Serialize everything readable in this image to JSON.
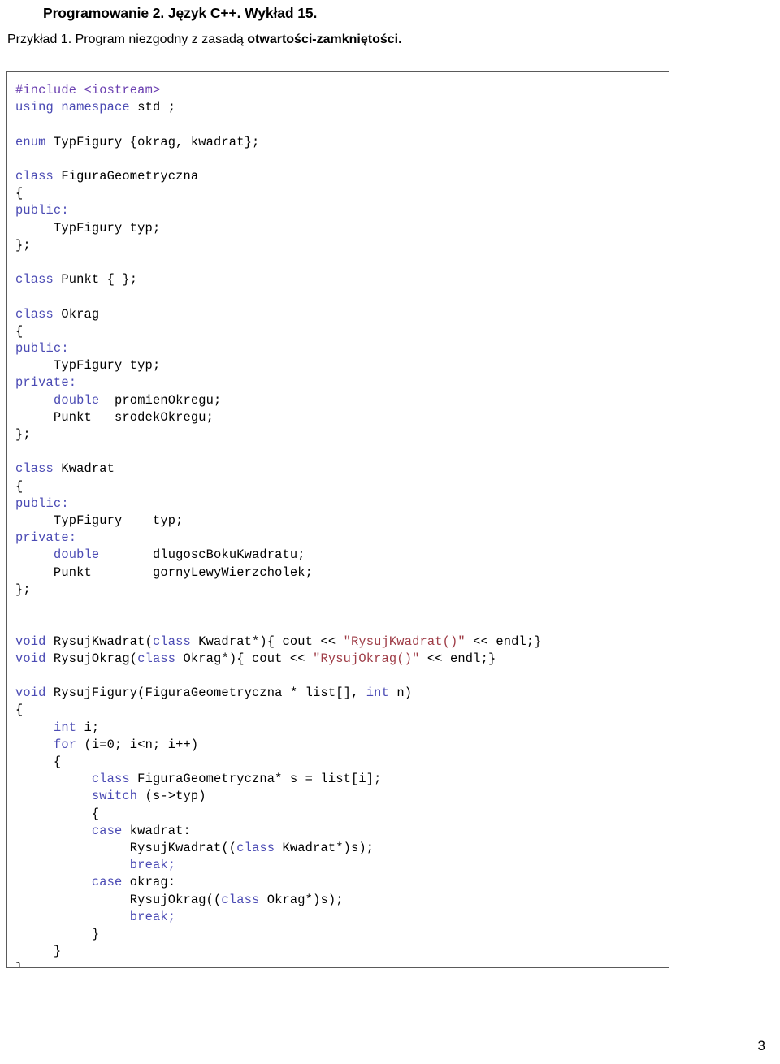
{
  "document": {
    "title": "Programowanie 2. Język C++. Wykład 15.",
    "example_prefix": "Przykład 1. Program niezgodny z zasadą ",
    "example_bold": "otwartości-zamkniętości.",
    "page_number": "3"
  },
  "colors": {
    "keyword": "#4b4bb4",
    "preprocessor": "#6a3fb0",
    "string": "#9e3b45",
    "plain": "#000000",
    "box_border": "#5a5a5a",
    "background": "#ffffff"
  },
  "code": {
    "language": "C++",
    "plain_text": "#include <iostream>\nusing namespace std ;\n\nenum TypFigury {okrag, kwadrat};\n\nclass FiguraGeometryczna\n{\npublic:\n     TypFigury typ;\n};\n\nclass Punkt { };\n\nclass Okrag\n{\npublic:\n     TypFigury typ;\nprivate:\n     double  promienOkregu;\n     Punkt   srodekOkregu;\n};\n\nclass Kwadrat\n{\npublic:\n     TypFigury    typ;\nprivate:\n     double       dlugoscBokuKwadratu;\n     Punkt        gornyLewyWierzcholek;\n};\n\n\nvoid RysujKwadrat(class Kwadrat*){ cout << \"RysujKwadrat()\" << endl;}\nvoid RysujOkrag(class Okrag*){ cout << \"RysujOkrag()\" << endl;}\n\nvoid RysujFigury(FiguraGeometryczna * list[], int n)\n{\n     int i;\n     for (i=0; i<n; i++)\n     {\n          class FiguraGeometryczna* s = list[i];\n          switch (s->typ)\n          {\n          case kwadrat:\n               RysujKwadrat((class Kwadrat*)s);\n               break;\n          case okrag:\n               RysujOkrag((class Okrag*)s);\n               break;\n          }\n     }\n}",
    "lines": [
      [
        {
          "t": "#include",
          "c": "pp"
        },
        {
          "t": " <iostream>",
          "c": "pp"
        }
      ],
      [
        {
          "t": "using",
          "c": "kw"
        },
        {
          "t": " ",
          "c": "pl"
        },
        {
          "t": "namespace",
          "c": "kw"
        },
        {
          "t": " std ;",
          "c": "pl"
        }
      ],
      [],
      [
        {
          "t": "enum",
          "c": "kw"
        },
        {
          "t": " TypFigury {okrag, kwadrat};",
          "c": "pl"
        }
      ],
      [],
      [
        {
          "t": "class",
          "c": "kw"
        },
        {
          "t": " FiguraGeometryczna",
          "c": "pl"
        }
      ],
      [
        {
          "t": "{",
          "c": "pl"
        }
      ],
      [
        {
          "t": "public:",
          "c": "kw"
        }
      ],
      [
        {
          "t": "     TypFigury typ;",
          "c": "pl"
        }
      ],
      [
        {
          "t": "};",
          "c": "pl"
        }
      ],
      [],
      [
        {
          "t": "class",
          "c": "kw"
        },
        {
          "t": " Punkt { };",
          "c": "pl"
        }
      ],
      [],
      [
        {
          "t": "class",
          "c": "kw"
        },
        {
          "t": " Okrag",
          "c": "pl"
        }
      ],
      [
        {
          "t": "{",
          "c": "pl"
        }
      ],
      [
        {
          "t": "public:",
          "c": "kw"
        }
      ],
      [
        {
          "t": "     TypFigury typ;",
          "c": "pl"
        }
      ],
      [
        {
          "t": "private:",
          "c": "kw"
        }
      ],
      [
        {
          "t": "     ",
          "c": "pl"
        },
        {
          "t": "double",
          "c": "kw"
        },
        {
          "t": "  promienOkregu;",
          "c": "pl"
        }
      ],
      [
        {
          "t": "     Punkt   srodekOkregu;",
          "c": "pl"
        }
      ],
      [
        {
          "t": "};",
          "c": "pl"
        }
      ],
      [],
      [
        {
          "t": "class",
          "c": "kw"
        },
        {
          "t": " Kwadrat",
          "c": "pl"
        }
      ],
      [
        {
          "t": "{",
          "c": "pl"
        }
      ],
      [
        {
          "t": "public:",
          "c": "kw"
        }
      ],
      [
        {
          "t": "     TypFigury    typ;",
          "c": "pl"
        }
      ],
      [
        {
          "t": "private:",
          "c": "kw"
        }
      ],
      [
        {
          "t": "     ",
          "c": "pl"
        },
        {
          "t": "double",
          "c": "kw"
        },
        {
          "t": "       dlugoscBokuKwadratu;",
          "c": "pl"
        }
      ],
      [
        {
          "t": "     Punkt        gornyLewyWierzcholek;",
          "c": "pl"
        }
      ],
      [
        {
          "t": "};",
          "c": "pl"
        }
      ],
      [],
      [],
      [
        {
          "t": "void",
          "c": "kw"
        },
        {
          "t": " RysujKwadrat(",
          "c": "pl"
        },
        {
          "t": "class",
          "c": "kw"
        },
        {
          "t": " Kwadrat*){ cout << ",
          "c": "pl"
        },
        {
          "t": "\"RysujKwadrat()\"",
          "c": "str"
        },
        {
          "t": " << endl;}",
          "c": "pl"
        }
      ],
      [
        {
          "t": "void",
          "c": "kw"
        },
        {
          "t": " RysujOkrag(",
          "c": "pl"
        },
        {
          "t": "class",
          "c": "kw"
        },
        {
          "t": " Okrag*){ cout << ",
          "c": "pl"
        },
        {
          "t": "\"RysujOkrag()\"",
          "c": "str"
        },
        {
          "t": " << endl;}",
          "c": "pl"
        }
      ],
      [],
      [
        {
          "t": "void",
          "c": "kw"
        },
        {
          "t": " RysujFigury(FiguraGeometryczna * list[], ",
          "c": "pl"
        },
        {
          "t": "int",
          "c": "kw"
        },
        {
          "t": " n)",
          "c": "pl"
        }
      ],
      [
        {
          "t": "{",
          "c": "pl"
        }
      ],
      [
        {
          "t": "     ",
          "c": "pl"
        },
        {
          "t": "int",
          "c": "kw"
        },
        {
          "t": " i;",
          "c": "pl"
        }
      ],
      [
        {
          "t": "     ",
          "c": "pl"
        },
        {
          "t": "for",
          "c": "kw"
        },
        {
          "t": " (i=0; i<n; i++)",
          "c": "pl"
        }
      ],
      [
        {
          "t": "     {",
          "c": "pl"
        }
      ],
      [
        {
          "t": "          ",
          "c": "pl"
        },
        {
          "t": "class",
          "c": "kw"
        },
        {
          "t": " FiguraGeometryczna* s = list[i];",
          "c": "pl"
        }
      ],
      [
        {
          "t": "          ",
          "c": "pl"
        },
        {
          "t": "switch",
          "c": "kw"
        },
        {
          "t": " (s->typ)",
          "c": "pl"
        }
      ],
      [
        {
          "t": "          {",
          "c": "pl"
        }
      ],
      [
        {
          "t": "          ",
          "c": "pl"
        },
        {
          "t": "case",
          "c": "kw"
        },
        {
          "t": " kwadrat:",
          "c": "pl"
        }
      ],
      [
        {
          "t": "               RysujKwadrat((",
          "c": "pl"
        },
        {
          "t": "class",
          "c": "kw"
        },
        {
          "t": " Kwadrat*)s);",
          "c": "pl"
        }
      ],
      [
        {
          "t": "               ",
          "c": "pl"
        },
        {
          "t": "break;",
          "c": "kw"
        }
      ],
      [
        {
          "t": "          ",
          "c": "pl"
        },
        {
          "t": "case",
          "c": "kw"
        },
        {
          "t": " okrag:",
          "c": "pl"
        }
      ],
      [
        {
          "t": "               RysujOkrag((",
          "c": "pl"
        },
        {
          "t": "class",
          "c": "kw"
        },
        {
          "t": " Okrag*)s);",
          "c": "pl"
        }
      ],
      [
        {
          "t": "               ",
          "c": "pl"
        },
        {
          "t": "break;",
          "c": "kw"
        }
      ],
      [
        {
          "t": "          }",
          "c": "pl"
        }
      ],
      [
        {
          "t": "     }",
          "c": "pl"
        }
      ],
      [
        {
          "t": "}",
          "c": "pl"
        }
      ]
    ]
  }
}
